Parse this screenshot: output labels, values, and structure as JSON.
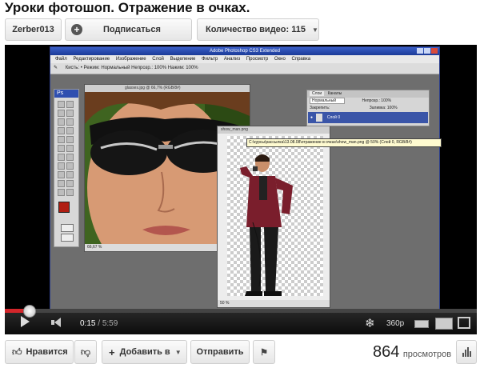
{
  "video_title": "Уроки фотошоп. Отражение в очках.",
  "channel": {
    "name": "Zerber013",
    "subscribe_label": "Подписаться",
    "videos_label": "Количество видео: 115"
  },
  "photoshop": {
    "window_title": "Adobe Photoshop CS3 Extended",
    "menu": [
      "Файл",
      "Редактирование",
      "Изображение",
      "Слой",
      "Выделение",
      "Фильтр",
      "Анализ",
      "Просмотр",
      "Окно",
      "Справка"
    ],
    "options_bar": "Кисть:  •  Режим:  Нормальный          Непрозр.: 100%   Нажим: 100%",
    "doc1_title": "glasses.jpg @ 66,7% (RGB/8#)",
    "doc1_zoom": "66,67 %",
    "doc2_title": "show_man.png",
    "doc2_zoom": "50 %",
    "tooltip": "C:\\курсы\\рассылка\\13.08.08\\отражение в очках\\show_man.png @ 50% (Слой 0, RGB/8#)",
    "layers_tab1": "Слои",
    "layers_tab2": "Каналы",
    "layers_mode": "Нормальный",
    "layers_opacity_label": "Непрозр.: 100%",
    "layers_fill_label": "Заливка: 100%",
    "layers_lock_label": "Закрепить:",
    "layer_name": "Слой 0",
    "ps_logo": "Ps"
  },
  "player": {
    "current_time": "0:15",
    "duration": "5:59",
    "quality": "360p",
    "progress": 0.042
  },
  "actions": {
    "like_label": "Нравится",
    "add_label": "Добавить в",
    "share_label": "Отправить",
    "views_count": "864",
    "views_label": "просмотров"
  },
  "colors": {
    "progress": "#d3262b",
    "foreground": "#b01e12",
    "background": "#8a5a1a"
  }
}
